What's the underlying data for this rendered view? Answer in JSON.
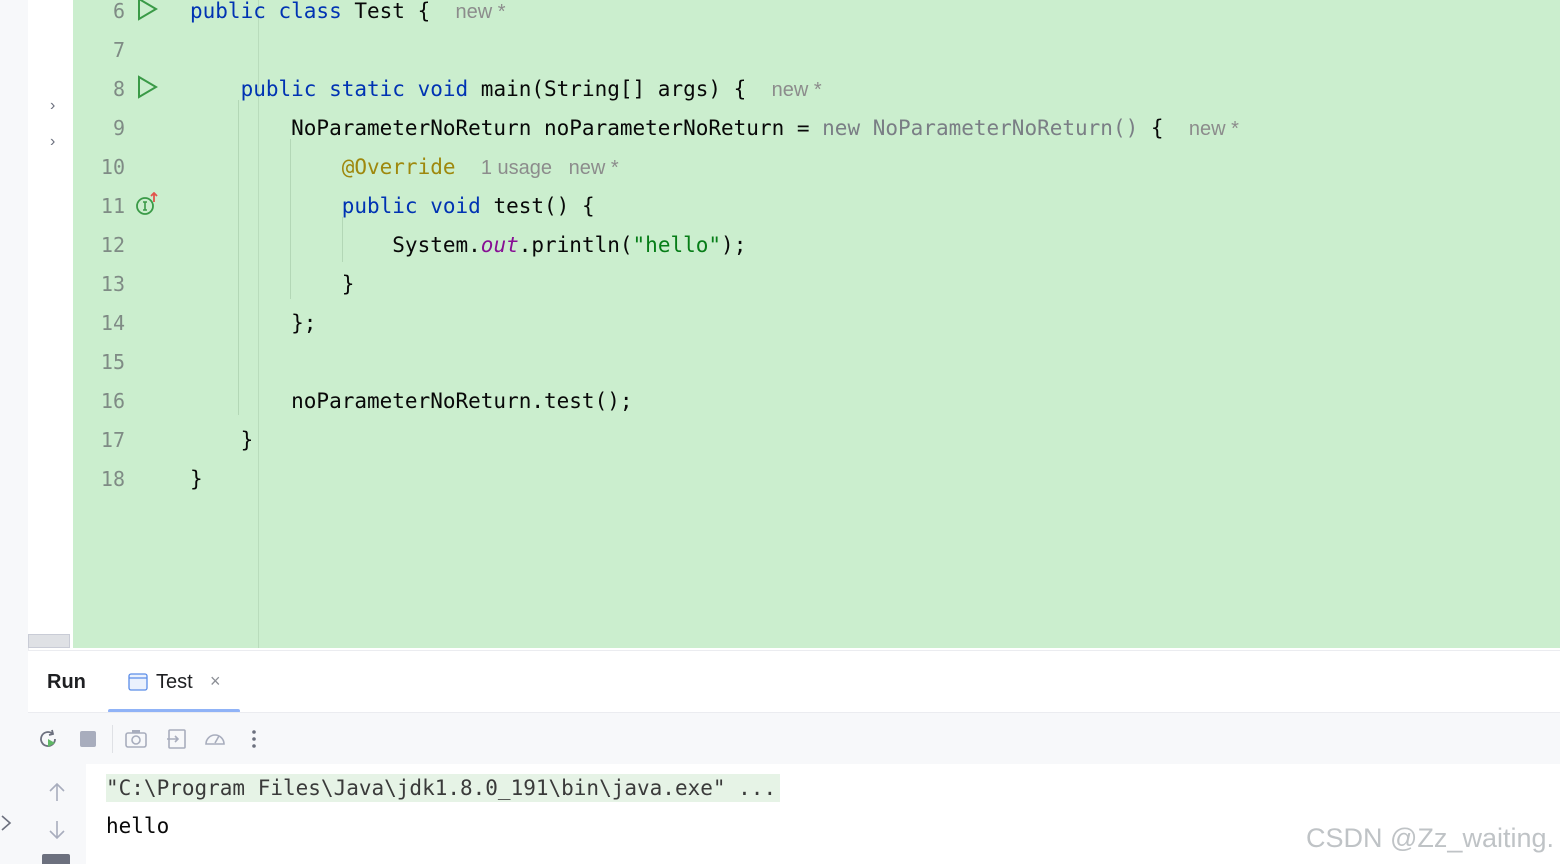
{
  "editor": {
    "lines": [
      {
        "num": "6",
        "parts": [
          {
            "t": "public class ",
            "c": "kw"
          },
          {
            "t": "Test {",
            "c": ""
          },
          {
            "t": "  ",
            "c": ""
          },
          {
            "t": "new *",
            "c": "hint"
          }
        ],
        "icon": "run"
      },
      {
        "num": "7",
        "parts": []
      },
      {
        "num": "8",
        "parts": [
          {
            "t": "    public static void ",
            "c": "kw"
          },
          {
            "t": "main(String[] args) {",
            "c": ""
          },
          {
            "t": "  ",
            "c": ""
          },
          {
            "t": "new *",
            "c": "hint"
          }
        ],
        "icon": "run"
      },
      {
        "num": "9",
        "parts": [
          {
            "t": "        NoParameterNoReturn noParameterNoReturn = ",
            "c": ""
          },
          {
            "t": "new NoParameterNoReturn()",
            "c": "grey"
          },
          {
            "t": " {",
            "c": ""
          },
          {
            "t": "  ",
            "c": ""
          },
          {
            "t": "new *",
            "c": "hint"
          }
        ]
      },
      {
        "num": "10",
        "parts": [
          {
            "t": "            ",
            "c": ""
          },
          {
            "t": "@Override",
            "c": "ann"
          },
          {
            "t": "  ",
            "c": ""
          },
          {
            "t": "1 usage   new *",
            "c": "hint"
          }
        ]
      },
      {
        "num": "11",
        "parts": [
          {
            "t": "            public void ",
            "c": "kw"
          },
          {
            "t": "test() {",
            "c": ""
          }
        ],
        "icon": "implements"
      },
      {
        "num": "12",
        "parts": [
          {
            "t": "                System.",
            "c": ""
          },
          {
            "t": "out",
            "c": "stat"
          },
          {
            "t": ".println(",
            "c": ""
          },
          {
            "t": "\"hello\"",
            "c": "str"
          },
          {
            "t": ");",
            "c": ""
          }
        ]
      },
      {
        "num": "13",
        "parts": [
          {
            "t": "            }",
            "c": ""
          }
        ]
      },
      {
        "num": "14",
        "parts": [
          {
            "t": "        };",
            "c": ""
          }
        ]
      },
      {
        "num": "15",
        "parts": []
      },
      {
        "num": "16",
        "parts": [
          {
            "t": "        noParameterNoReturn.test();",
            "c": ""
          }
        ]
      },
      {
        "num": "17",
        "parts": [
          {
            "t": "    }",
            "c": ""
          }
        ]
      },
      {
        "num": "18",
        "parts": [
          {
            "t": "}",
            "c": ""
          }
        ]
      }
    ],
    "background": "#cbeece"
  },
  "run_panel": {
    "title": "Run",
    "tab_label": "Test",
    "tab_close": "×",
    "toolbar": [
      {
        "name": "rerun-icon",
        "enabled": true
      },
      {
        "name": "stop-icon",
        "enabled": false
      },
      {
        "name": "screenshot-icon",
        "enabled": false
      },
      {
        "name": "exit-icon",
        "enabled": false
      },
      {
        "name": "profiler-icon",
        "enabled": false
      },
      {
        "name": "more-icon",
        "enabled": true
      }
    ],
    "console": {
      "command": "\"C:\\Program Files\\Java\\jdk1.8.0_191\\bin\\java.exe\" ...",
      "output": "hello"
    }
  },
  "watermark": "CSDN @Zz_waiting."
}
